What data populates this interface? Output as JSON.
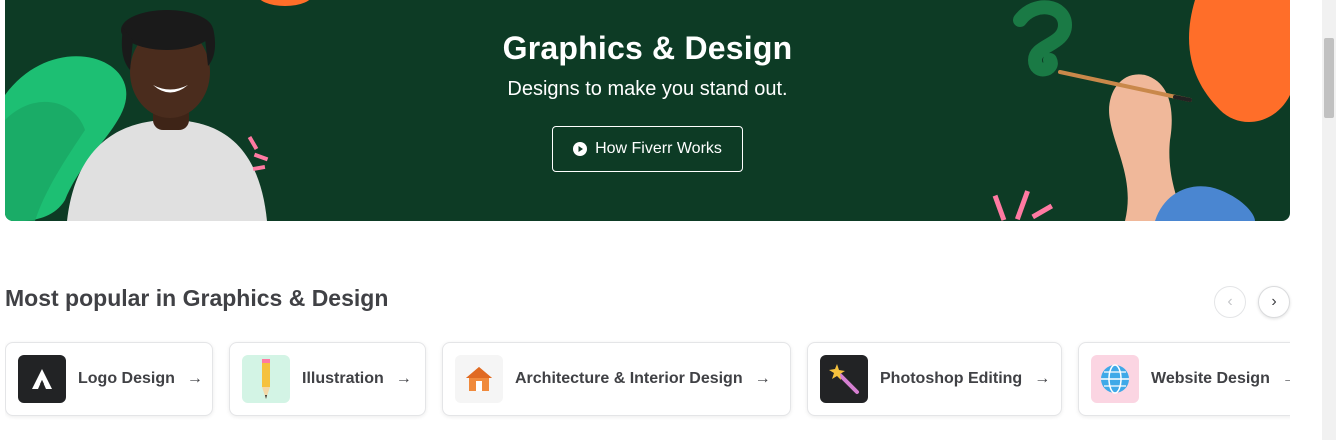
{
  "hero": {
    "title": "Graphics & Design",
    "subtitle": "Designs to make you stand out.",
    "cta_label": "How Fiverr Works",
    "background_color": "#0d3b25"
  },
  "popular": {
    "title": "Most popular in Graphics & Design",
    "prev_icon": "chevron-left-icon",
    "next_icon": "chevron-right-icon",
    "cards": [
      {
        "label": "Logo Design",
        "icon": "logo-design-icon",
        "icon_bg": "#222325"
      },
      {
        "label": "Illustration",
        "icon": "pencil-icon",
        "icon_bg": "#d3f4e5"
      },
      {
        "label": "Architecture & Interior Design",
        "icon": "house-icon",
        "icon_bg": "#f5f5f5"
      },
      {
        "label": "Photoshop Editing",
        "icon": "magic-wand-icon",
        "icon_bg": "#222325"
      },
      {
        "label": "Website Design",
        "icon": "globe-icon",
        "icon_bg": "#fbd5e2"
      }
    ]
  }
}
